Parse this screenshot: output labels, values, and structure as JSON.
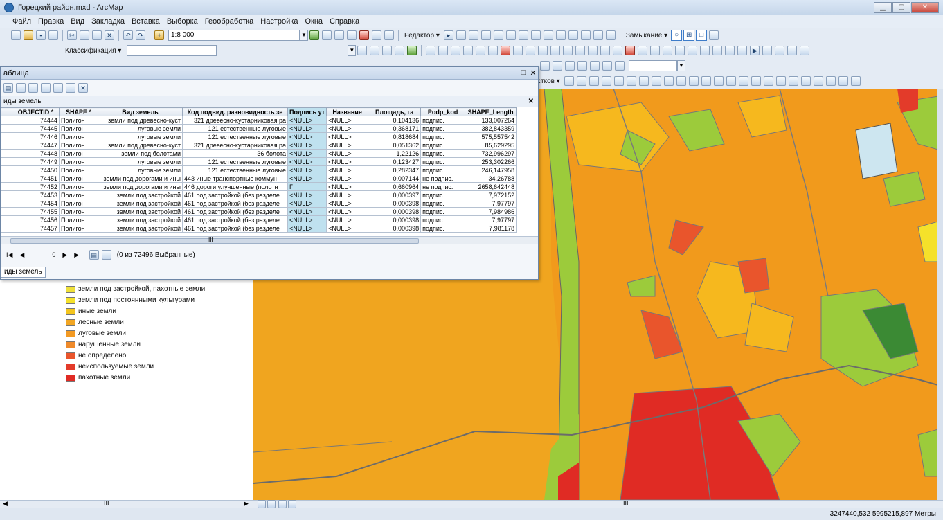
{
  "window": {
    "title": "Горецкий район.mxd - ArcMap"
  },
  "menu": [
    "Файл",
    "Правка",
    "Вид",
    "Закладка",
    "Вставка",
    "Выборка",
    "Геообработка",
    "Настройка",
    "Окна",
    "Справка"
  ],
  "toolbar": {
    "scale": "1:8 000",
    "editor_label": "Редактор ▾",
    "snapping_label": "Замыкание ▾",
    "classification_label": "Классификация ▾",
    "layer_partial_label": "стков ▾"
  },
  "table_window": {
    "title": "аблица",
    "tab_title": "иды земель",
    "nav_status": "(0 из 72496 Выбранные)",
    "nav_record": "0",
    "bottom_tab": "иды земель",
    "scroll_marker": "III",
    "columns": [
      "OBJECTID *",
      "SHAPE *",
      "Вид земель",
      "Код подвид. разновидность зе",
      "Подпись ут",
      "Название",
      "Площадь, га",
      "Podp_kod",
      "SHAPE_Length"
    ],
    "rows": [
      [
        "74444",
        "Полигон",
        "земли под древесно-куст",
        "321 древесно-кустарниковая ра",
        "<NULL>",
        "<NULL>",
        "0,104136",
        "подпис.",
        "133,007264"
      ],
      [
        "74445",
        "Полигон",
        "луговые земли",
        "121 естественные луговые",
        "<NULL>",
        "<NULL>",
        "0,368171",
        "подпис.",
        "382,843359"
      ],
      [
        "74446",
        "Полигон",
        "луговые земли",
        "121 естественные луговые",
        "<NULL>",
        "<NULL>",
        "0,818684",
        "подпис.",
        "575,557542"
      ],
      [
        "74447",
        "Полигон",
        "земли под древесно-куст",
        "321 древесно-кустарниковая ра",
        "<NULL>",
        "<NULL>",
        "0,051362",
        "подпис.",
        "85,629295"
      ],
      [
        "74448",
        "Полигон",
        "земли под болотами",
        "36 болота",
        "<NULL>",
        "<NULL>",
        "1,22126",
        "подпис.",
        "732,996297"
      ],
      [
        "74449",
        "Полигон",
        "луговые земли",
        "121 естественные луговые",
        "<NULL>",
        "<NULL>",
        "0,123427",
        "подпис.",
        "253,302266"
      ],
      [
        "74450",
        "Полигон",
        "луговые земли",
        "121 естественные луговые",
        "<NULL>",
        "<NULL>",
        "0,282347",
        "подпис.",
        "246,147958"
      ],
      [
        "74451",
        "Полигон",
        "земли под дорогами и ины",
        "443 иные транспортные коммун",
        "<NULL>",
        "<NULL>",
        "0,007144",
        "не подпис.",
        "34,26788"
      ],
      [
        "74452",
        "Полигон",
        "земли под дорогами и ины",
        "446 дороги улучшенные (полотн",
        "Г",
        "<NULL>",
        "0,660964",
        "не подпис.",
        "2658,642448"
      ],
      [
        "74453",
        "Полигон",
        "земли под застройкой",
        "461 под застройкой (без разделе",
        "<NULL>",
        "<NULL>",
        "0,000397",
        "подпис.",
        "7,972152"
      ],
      [
        "74454",
        "Полигон",
        "земли под застройкой",
        "461 под застройкой (без разделе",
        "<NULL>",
        "<NULL>",
        "0,000398",
        "подпис.",
        "7,97797"
      ],
      [
        "74455",
        "Полигон",
        "земли под застройкой",
        "461 под застройкой (без разделе",
        "<NULL>",
        "<NULL>",
        "0,000398",
        "подпис.",
        "7,984986"
      ],
      [
        "74456",
        "Полигон",
        "земли под застройкой",
        "461 под застройкой (без разделе",
        "<NULL>",
        "<NULL>",
        "0,000398",
        "подпис.",
        "7,97797"
      ],
      [
        "74457",
        "Полигон",
        "земли под застройкой",
        "461 под застройкой (без разделе",
        "<NULL>",
        "<NULL>",
        "0,000398",
        "подпис.",
        "7,981178"
      ]
    ]
  },
  "legend": [
    {
      "label": "земли под застройкой, пахотные земли",
      "color": "#efe03a"
    },
    {
      "label": "земли под постоянными культурами",
      "color": "#f5e12a"
    },
    {
      "label": "иные земли",
      "color": "#f4c51e"
    },
    {
      "label": "лесные земли",
      "color": "#f2a623"
    },
    {
      "label": "луговые земли",
      "color": "#f39a23"
    },
    {
      "label": "нарушенные земли",
      "color": "#ef8a2a"
    },
    {
      "label": "не определено",
      "color": "#e9552c"
    },
    {
      "label": "неиспользуемые земли",
      "color": "#e33b2a"
    },
    {
      "label": "пахотные земли",
      "color": "#e02b24"
    }
  ],
  "status": {
    "coords": "3247440,532 5995215,897 Метры"
  },
  "bottom": {
    "scroll_marker": "III"
  }
}
